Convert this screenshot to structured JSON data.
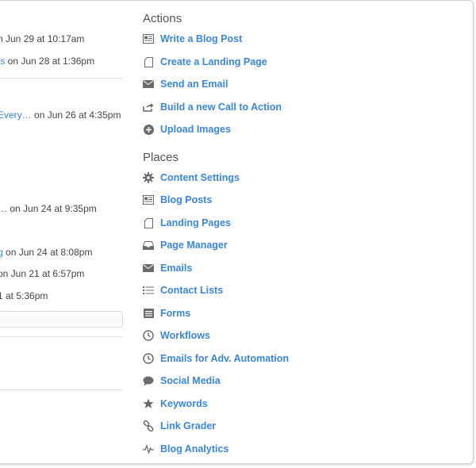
{
  "activity": [
    {
      "link": "",
      "text": "n Jun 29 at 10:17am"
    },
    {
      "link": "ts",
      "text": " on Jun 28 at 1:36pm"
    },
    {
      "link": "Every…",
      "text": " on Jun 26 at 4:35pm"
    },
    {
      "link": "",
      "text": "…  on Jun 24 at 9:35pm"
    },
    {
      "link": "g",
      "text": " on Jun 24 at 8:08pm"
    },
    {
      "link": "",
      "text": " on Jun 21 at 6:57pm"
    },
    {
      "link": "",
      "text": "1 at 5:36pm"
    }
  ],
  "actions": {
    "title": "Actions",
    "items": [
      {
        "label": "Write a Blog Post",
        "icon": "blog-post-icon"
      },
      {
        "label": "Create a Landing Page",
        "icon": "page-icon"
      },
      {
        "label": "Send an Email",
        "icon": "envelope-icon"
      },
      {
        "label": "Build a new Call to Action",
        "icon": "share-arrow-icon"
      },
      {
        "label": "Upload Images",
        "icon": "plus-circle-icon"
      }
    ]
  },
  "places": {
    "title": "Places",
    "items": [
      {
        "label": "Content Settings",
        "icon": "gear-icon"
      },
      {
        "label": "Blog Posts",
        "icon": "blog-post-icon"
      },
      {
        "label": "Landing Pages",
        "icon": "page-icon"
      },
      {
        "label": "Page Manager",
        "icon": "inbox-tray-icon"
      },
      {
        "label": "Emails",
        "icon": "envelope-icon"
      },
      {
        "label": "Contact Lists",
        "icon": "list-icon"
      },
      {
        "label": "Forms",
        "icon": "form-icon"
      },
      {
        "label": "Workflows",
        "icon": "clock-icon"
      },
      {
        "label": "Emails for Adv. Automation",
        "icon": "clock-icon"
      },
      {
        "label": "Social Media",
        "icon": "speech-bubble-icon"
      },
      {
        "label": "Keywords",
        "icon": "star-icon"
      },
      {
        "label": "Link Grader",
        "icon": "link-icon"
      },
      {
        "label": "Blog Analytics",
        "icon": "pulse-icon"
      }
    ]
  },
  "colors": {
    "link": "#3a86d9",
    "icon": "#6b6b6b",
    "heading": "#555555"
  }
}
